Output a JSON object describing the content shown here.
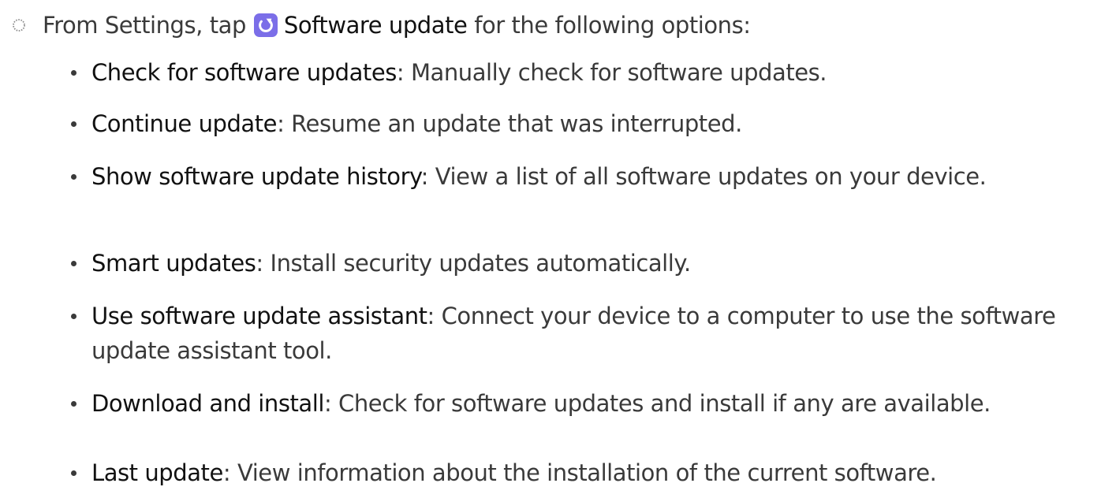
{
  "intro": {
    "before": "From Settings, tap",
    "app_label": "Software update",
    "after": "for the following options:",
    "icon": "software-update-icon",
    "icon_color": "#7b6ee8"
  },
  "options": [
    {
      "term": "Check for software updates",
      "desc": ": Manually check for software updates."
    },
    {
      "term": "Continue update",
      "desc": ": Resume an update that was interrupted."
    },
    {
      "term": "Show software update history",
      "desc": ": View a list of all software updates on your device."
    },
    {
      "term": "Smart updates",
      "desc": ": Install security updates automatically."
    },
    {
      "term": "Use software update assistant",
      "desc": ": Connect your device to a computer to use the software update assistant tool."
    },
    {
      "term": "Download and install",
      "desc": ": Check for software updates and install if any are available."
    },
    {
      "term": "Last update",
      "desc": ": View information about the installation of the current software."
    }
  ]
}
